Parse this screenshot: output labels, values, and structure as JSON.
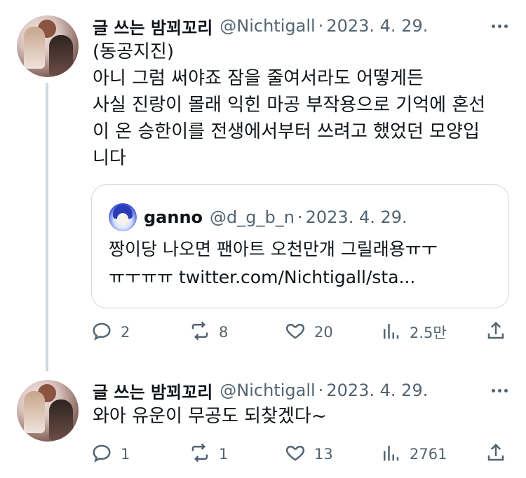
{
  "tweets": [
    {
      "author_name": "글 쓰는 밤꾀꼬리",
      "handle": "@Nichtigall",
      "separator": "·",
      "date": "2023. 4. 29.",
      "text": "(동공지진)\n아니 그럼 써야죠 잠을 줄여서라도 어떻게든\n사실 진랑이 몰래 익힌 마공 부작용으로 기억에 혼선\n이 온 승한이를 전생에서부터 쓰려고 했었던 모양입\n니다",
      "quote": {
        "author_name": "ganno",
        "handle": "@d_g_b_n",
        "separator": "·",
        "date": "2023. 4. 29.",
        "text": "짱이당 나오면 팬아트 오천만개 그릴래용ㅠㅜ\nㅠㅜㅠㅠ twitter.com/Nichtigall/sta..."
      },
      "actions": {
        "replies": "2",
        "retweets": "8",
        "likes": "20",
        "views": "2.5만"
      }
    },
    {
      "author_name": "글 쓰는 밤꾀꼬리",
      "handle": "@Nichtigall",
      "separator": "·",
      "date": "2023. 4. 29.",
      "text": "와아 유운이 무공도 되찾겠다~",
      "actions": {
        "replies": "1",
        "retweets": "1",
        "likes": "13",
        "views": "2761"
      }
    }
  ],
  "icons": {
    "reply": "reply-icon",
    "retweet": "retweet-icon",
    "like": "heart-icon",
    "views": "views-icon",
    "share": "share-icon",
    "more": "more-icon"
  },
  "colors": {
    "text": "#0f1419",
    "secondary": "#536471",
    "border": "#cfd9de"
  }
}
